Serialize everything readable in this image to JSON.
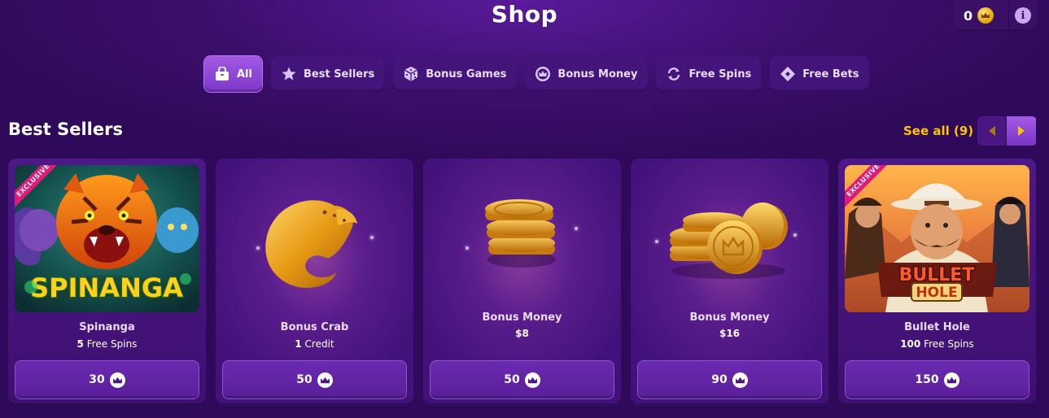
{
  "header": {
    "title": "Shop",
    "balance": "0"
  },
  "tabs": [
    {
      "label": "All",
      "icon": "bag-icon",
      "active": true
    },
    {
      "label": "Best Sellers",
      "icon": "star-icon",
      "active": false
    },
    {
      "label": "Bonus Games",
      "icon": "dice-icon",
      "active": false
    },
    {
      "label": "Bonus Money",
      "icon": "crown-coin-icon",
      "active": false
    },
    {
      "label": "Free Spins",
      "icon": "refresh-icon",
      "active": false
    },
    {
      "label": "Free Bets",
      "icon": "ticket-icon",
      "active": false
    }
  ],
  "section": {
    "title": "Best Sellers",
    "see_all": "See all (9)"
  },
  "cards": [
    {
      "name": "Spinanga",
      "amount": "5",
      "unit": " Free Spins",
      "price": "30",
      "badge": "EXCLUSIVE",
      "logo": "SPINANGA"
    },
    {
      "name": "Bonus Crab",
      "amount": "1",
      "unit": " Credit",
      "price": "50"
    },
    {
      "name": "Bonus Money",
      "amount": "$8",
      "unit": "",
      "price": "50"
    },
    {
      "name": "Bonus Money",
      "amount": "$16",
      "unit": "",
      "price": "90"
    },
    {
      "name": "Bullet Hole",
      "amount": "100",
      "unit": " Free Spins",
      "price": "150",
      "badge": "EXCLUSIVE",
      "logo_line1": "BULLET",
      "logo_line2": "HOLE"
    }
  ],
  "colors": {
    "accent": "#ffc400",
    "background": "#3c0f6e",
    "ribbon": "#e0197a"
  }
}
